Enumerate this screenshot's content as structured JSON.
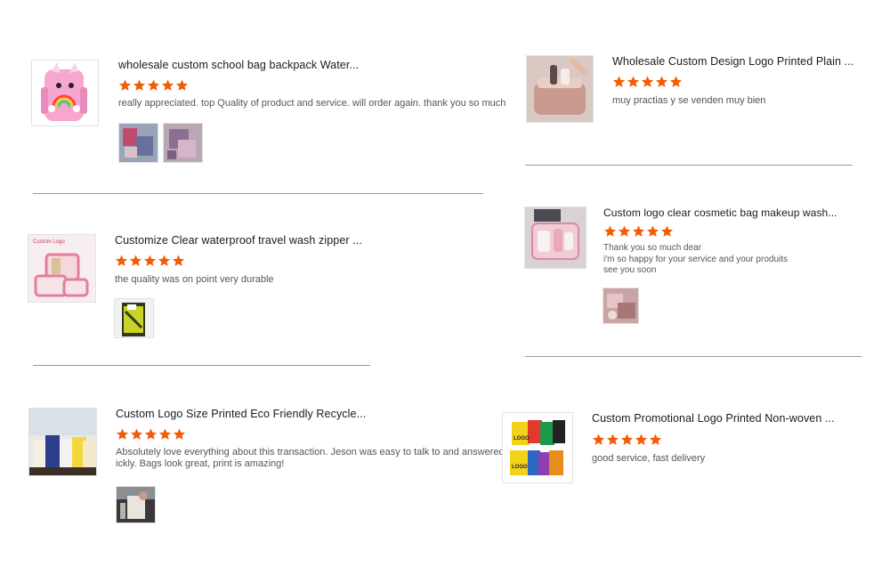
{
  "colors": {
    "star": "#f25c05",
    "divider": "#9a9a9a"
  },
  "reviews": [
    {
      "product_title": "wholesale custom school bag backpack Water...",
      "rating": 5,
      "comment_lines": [
        "really appreciated. top Quality of product and service. will order again. thank you so much"
      ],
      "thumbnail": "pink-unicorn-backpack-icon"
    },
    {
      "product_title": "Wholesale Custom Design Logo Printed Plain ...",
      "rating": 5,
      "comment_lines": [
        "muy practias y se venden muy bien"
      ],
      "thumbnail": "pink-cosmetic-case-icon"
    },
    {
      "product_title": "Customize Clear waterproof travel wash zipper ...",
      "rating": 5,
      "comment_lines": [
        "the quality was on point very durable"
      ],
      "thumbnail": "clear-wash-bag-set-icon",
      "thumbnail_caption": "Custom Logo"
    },
    {
      "product_title": "Custom logo clear cosmetic bag makeup wash...",
      "rating": 5,
      "comment_lines": [
        "Thank you so much dear",
        "i'm so happy for your service and your produits",
        "see you soon"
      ],
      "thumbnail": "clear-makeup-bag-icon"
    },
    {
      "product_title": "Custom Logo Size Printed Eco Friendly Recycle...",
      "rating": 5,
      "comment_lines": [
        "Absolutely love everything about this transaction. Jeson was easy to talk to and answered my",
        "ickly. Bags look great, print is amazing!"
      ],
      "thumbnail": "eco-tote-bags-icon"
    },
    {
      "product_title": "Custom Promotional Logo Printed Non-woven ...",
      "rating": 5,
      "comment_lines": [
        "good service, fast delivery"
      ],
      "thumbnail": "non-woven-bags-icon",
      "thumbnail_label": "LOGO"
    }
  ]
}
